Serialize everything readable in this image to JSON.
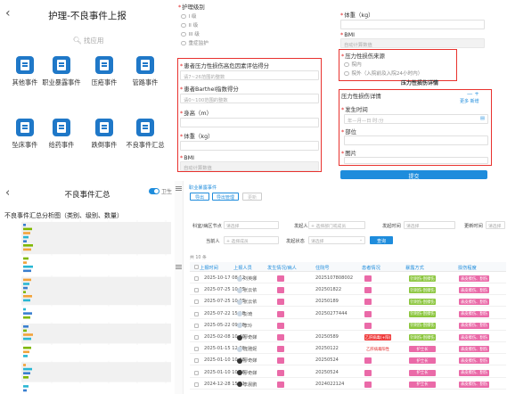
{
  "panel_a": {
    "back_icon": "chevron-left-icon",
    "title": "护理-不良事件上报",
    "search_placeholder": "找应用",
    "tiles": [
      {
        "label": "其他事件",
        "icon": "document-icon"
      },
      {
        "label": "职业暴露事件",
        "icon": "document-icon"
      },
      {
        "label": "压疮事件",
        "icon": "document-icon"
      },
      {
        "label": "管路事件",
        "icon": "chat-icon"
      },
      {
        "label": "坠床事件",
        "icon": "document-icon"
      },
      {
        "label": "给药事件",
        "icon": "document-icon"
      },
      {
        "label": "跌倒事件",
        "icon": "document-icon"
      },
      {
        "label": "不良事件汇总",
        "icon": "bar-chart-icon"
      }
    ]
  },
  "panel_b": {
    "left": {
      "care_level_label": "护理级别",
      "care_levels": [
        "I 级",
        "II 级",
        "III 级",
        "重症监护"
      ],
      "pressure_score_label": "患者压力性损伤高危因素评估得分",
      "pressure_score_placeholder": "请7~26范围的整数",
      "barthel_label": "患者Barthel指数得分",
      "barthel_placeholder": "请0~100范围的整数",
      "height_label": "身高（m）",
      "weight_label": "体重（kg）",
      "bmi_label": "BMI",
      "bmi_placeholder": "自动计算数值"
    },
    "right": {
      "weight_label": "体重（kg）",
      "bmi_label": "BMI",
      "bmi_placeholder": "自动计算数值",
      "source_label": "压力性损伤来源",
      "source_options": [
        "院内",
        "院外（入院前及入院24小时内）"
      ],
      "detail_button": "压力性损伤详情",
      "detail_section_label": "压力性损伤详情",
      "detail_actions": "—  +",
      "detail_sub": "更多  新增",
      "occur_time_label": "发生时间",
      "occur_time_placeholder": "年—月—日 时:分",
      "location_label": "部位",
      "photo_label": "图片",
      "submit_label": "提交"
    }
  },
  "panel_c": {
    "back_icon": "chevron-left-icon",
    "title": "不良事件汇总",
    "toggle_label": "卫生",
    "chart_title": "不良事件汇总分析图（类别、级别、数量）"
  },
  "panel_d": {
    "breadcrumb": "职业暴露事件",
    "buttons": [
      "导出",
      "导出管理",
      "更新"
    ],
    "filters": {
      "dept_label": "科室/病区节点",
      "dept_value": "请选择",
      "reporter_label": "发起人",
      "reporter_value": "+ 选择部门或成员",
      "time_label": "发起时间",
      "time_value": "请选择",
      "update_label": "更新时间",
      "update_value": "请选择",
      "handler_label": "当前人",
      "handler_value": "+ 选择成员",
      "status_label": "发起状态",
      "status_value": "请选择",
      "query_label": "查询"
    },
    "count_text": "共 10 条",
    "columns": [
      "上报时间",
      "上报人员",
      "发生情况/病人",
      "住院号",
      "患者情况",
      "暴露方式",
      "损伤程度"
    ],
    "rows": [
      {
        "time": "2025-10-17 08:52",
        "person": "刘英娜",
        "id": "2025107808002",
        "avatar": "light"
      },
      {
        "time": "2025-07-25 10:05",
        "person": "张云依",
        "id": "202501822",
        "avatar": "light"
      },
      {
        "time": "2025-07-25 10:05",
        "person": "张云依",
        "id": "20250189",
        "avatar": "light"
      },
      {
        "time": "2025-07-22 15:18",
        "person": "彭琦",
        "id": "20250277444",
        "avatar": "light"
      },
      {
        "time": "2025-05-22 09:08",
        "person": "李玲",
        "id": "",
        "avatar": "light"
      },
      {
        "time": "2025-02-08 10:40",
        "person": "廖奇娣",
        "id": "20250589",
        "avatar": "dark"
      },
      {
        "time": "2025-01-15 12:08",
        "person": "庞雅妮",
        "id": "20250122",
        "avatar": "light"
      },
      {
        "time": "2025-01-10 10:28",
        "person": "廖奇娣",
        "id": "20250524",
        "avatar": "dark"
      },
      {
        "time": "2025-01-10 10:28",
        "person": "廖奇娣",
        "id": "20250524",
        "avatar": "dark"
      },
      {
        "time": "2024-12-28 15:21",
        "person": "李晨鹏",
        "id": "2024022124",
        "avatar": "dark"
      }
    ],
    "status_text": {
      "exposure_a": "乙肝病毒(+阳)",
      "exposure_b": "乙肝病毒阳性",
      "mode": "针刺伤-刮擦伤",
      "mode_b": "护士长",
      "harm": "表皮擦伤、割伤"
    }
  },
  "colors": {
    "accent": "#1e8cdc",
    "highlight_box": "#e8322e",
    "tag_pink": "#ea6aa8",
    "tag_green": "#8cc63f"
  }
}
